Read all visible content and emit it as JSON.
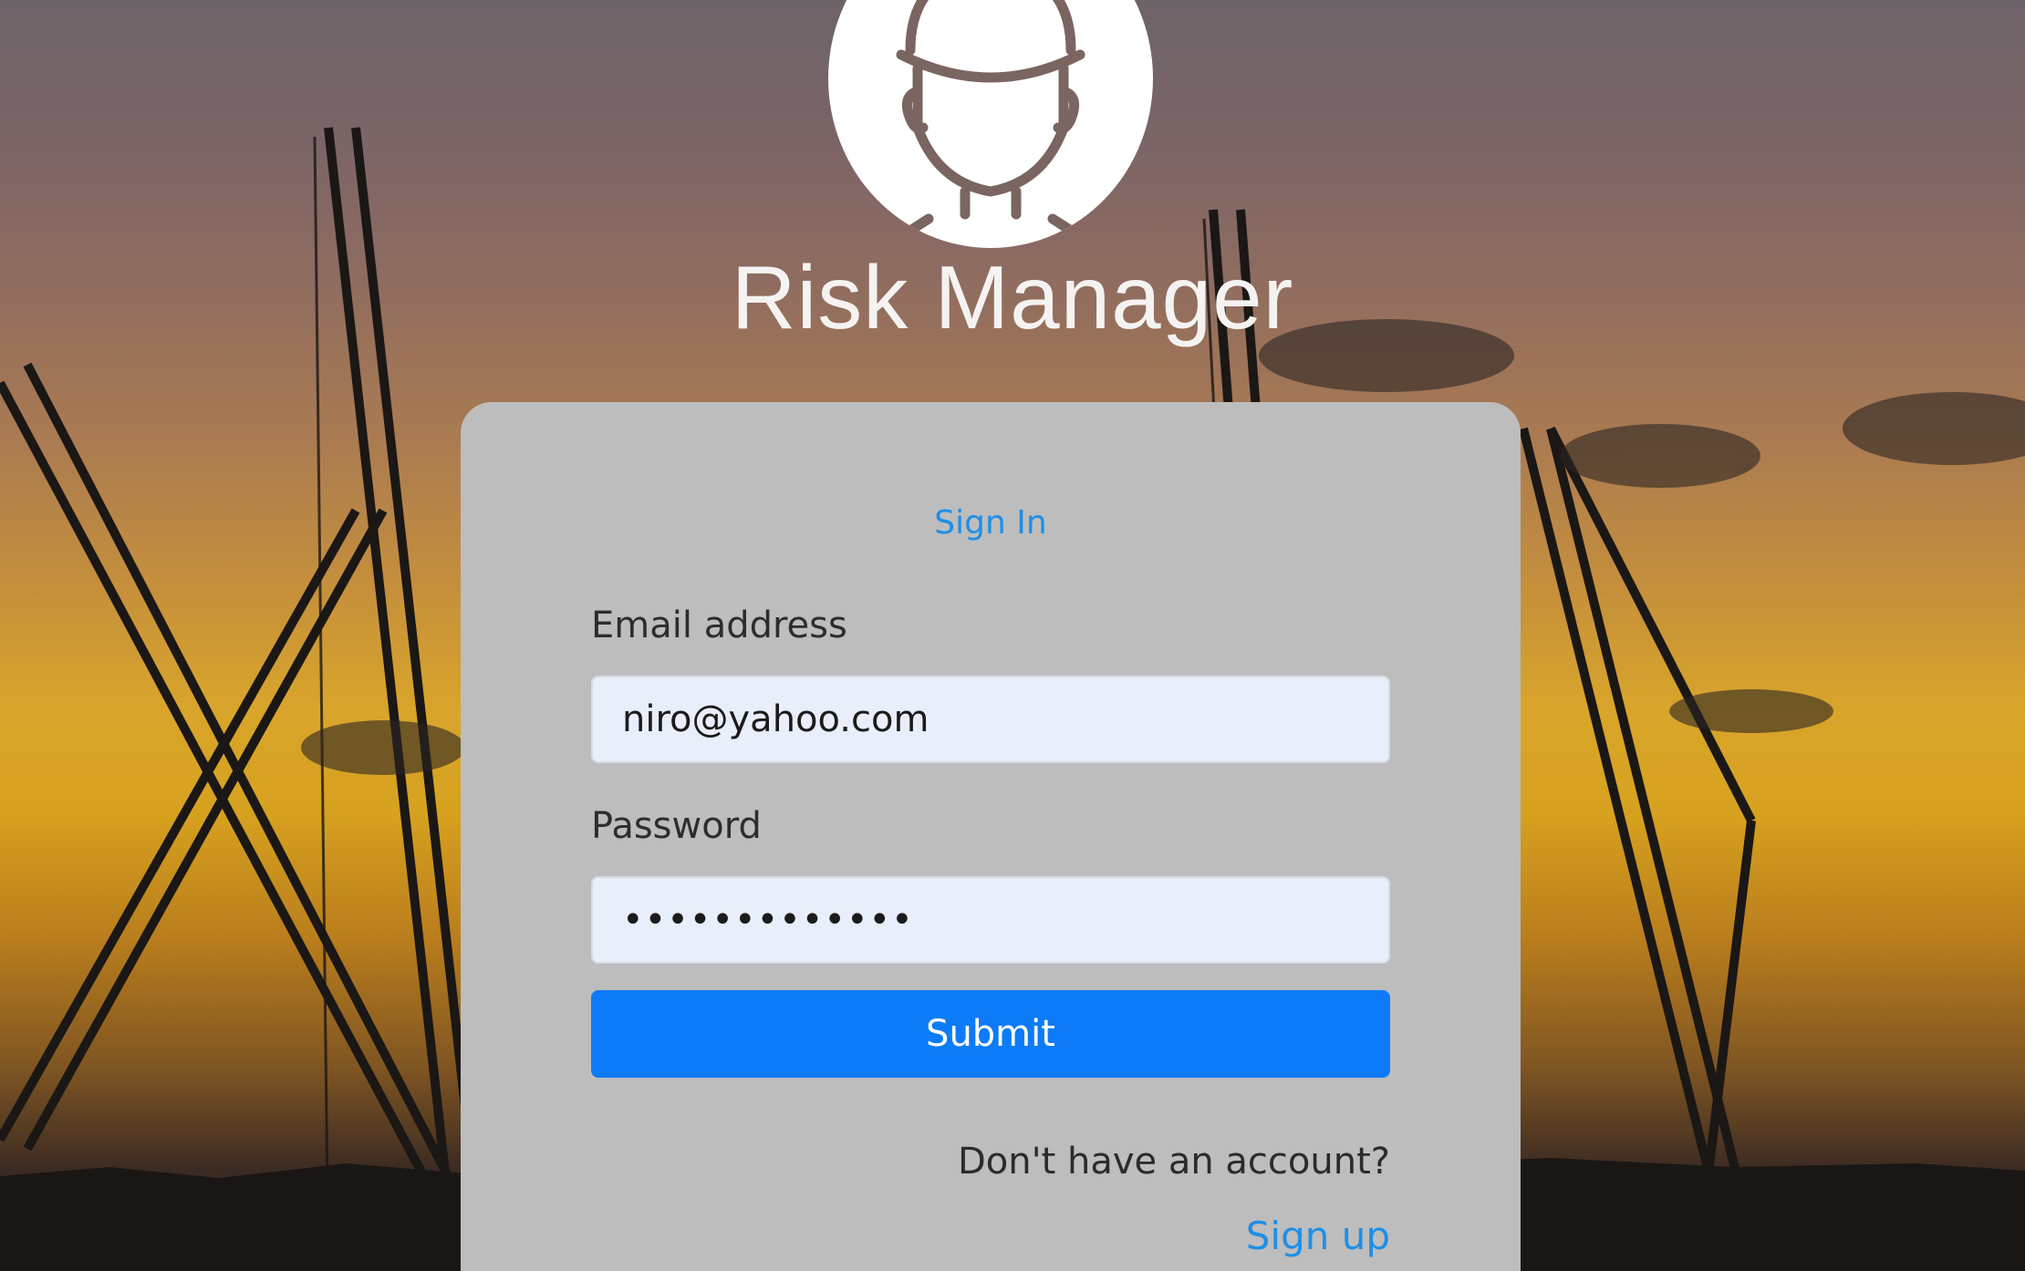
{
  "brand": {
    "title": "Risk Manager",
    "logo_icon": "construction-worker-helmet-icon"
  },
  "form": {
    "title": "Sign In",
    "email": {
      "label": "Email address",
      "value": "niro@yahoo.com"
    },
    "password": {
      "label": "Password",
      "value": "•••••••••••••"
    },
    "submit_label": "Submit",
    "no_account_text": "Don't have an account?",
    "signup_link": "Sign up"
  },
  "colors": {
    "accent": "#0d7bf7",
    "link": "#1d8fe6",
    "card": "#bdbdbd",
    "input_bg": "#e8eefa"
  }
}
